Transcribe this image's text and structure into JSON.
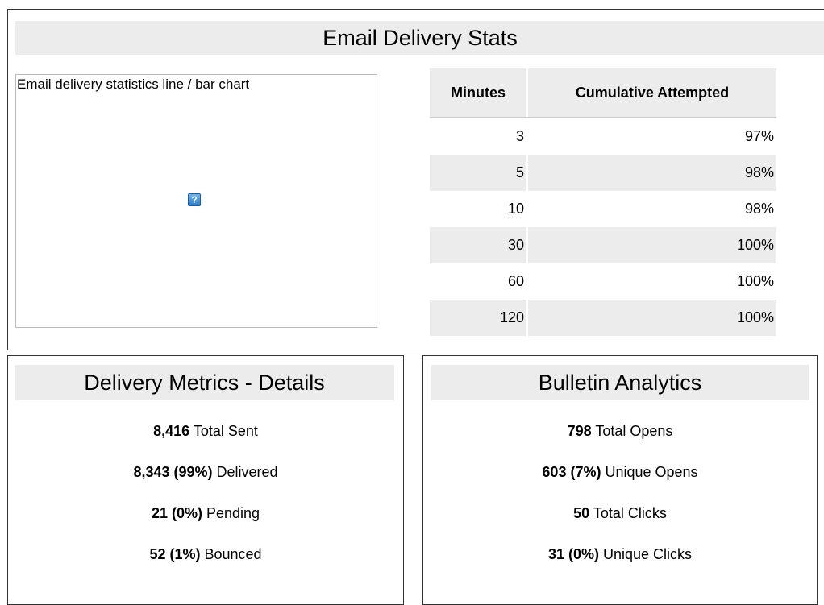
{
  "stats": {
    "title": "Email Delivery Stats",
    "chart_alt": "Email delivery statistics line / bar chart",
    "broken_image_glyph": "?",
    "table": {
      "headers": [
        "Minutes",
        "Cumulative Attempted"
      ],
      "rows": [
        {
          "minutes": "3",
          "cumulative": "97%"
        },
        {
          "minutes": "5",
          "cumulative": "98%"
        },
        {
          "minutes": "10",
          "cumulative": "98%"
        },
        {
          "minutes": "30",
          "cumulative": "100%"
        },
        {
          "minutes": "60",
          "cumulative": "100%"
        },
        {
          "minutes": "120",
          "cumulative": "100%"
        }
      ]
    }
  },
  "metrics": {
    "title": "Delivery Metrics - Details",
    "items": [
      {
        "value": "8,416",
        "label": "Total Sent"
      },
      {
        "value": "8,343 (99%)",
        "label": "Delivered"
      },
      {
        "value": "21 (0%)",
        "label": "Pending"
      },
      {
        "value": "52 (1%)",
        "label": "Bounced"
      }
    ]
  },
  "analytics": {
    "title": "Bulletin Analytics",
    "items": [
      {
        "value": "798",
        "label": "Total Opens"
      },
      {
        "value": "603 (7%)",
        "label": "Unique Opens"
      },
      {
        "value": "50",
        "label": "Total Clicks"
      },
      {
        "value": "31 (0%)",
        "label": "Unique Clicks"
      }
    ]
  },
  "colors": {
    "header_bg": "#ececec",
    "border": "#333333",
    "icon_blue": "#2d7ec9"
  }
}
